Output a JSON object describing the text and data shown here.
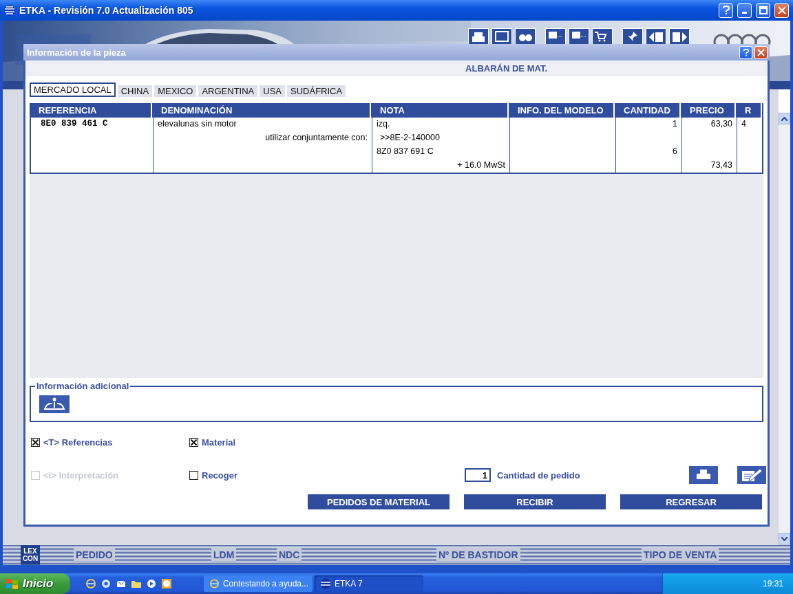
{
  "window": {
    "title": "ETKA - Revisión 7.0 Actualización 805"
  },
  "main_footer": {
    "logo_lines": [
      "LEX",
      "CON"
    ],
    "items": [
      "PEDIDO",
      "LDM",
      "NDC",
      "Nº DE BASTIDOR",
      "TIPO DE VENTA"
    ]
  },
  "dialog": {
    "title": "Información de la pieza",
    "heading": "ALBARÁN DE MAT.",
    "tabs": [
      {
        "label": "MERCADO LOCAL",
        "selected": true
      },
      {
        "label": "CHINA",
        "selected": false
      },
      {
        "label": "MEXICO",
        "selected": false
      },
      {
        "label": "ARGENTINA",
        "selected": false
      },
      {
        "label": "USA",
        "selected": false
      },
      {
        "label": "SUDÁFRICA",
        "selected": false
      }
    ],
    "table": {
      "columns": [
        "REFERENCIA",
        "DENOMINACIÓN",
        "NOTA",
        "INFO. DEL MODELO",
        "CANTIDAD",
        "PRECIO",
        "R"
      ],
      "rows": [
        {
          "kind": "part",
          "cells": [
            "8E0 839 461 C",
            "elevalunas sin motor",
            "izq.",
            "",
            "1",
            "63,30",
            "4"
          ]
        },
        {
          "kind": "link",
          "cells": [
            "",
            "utilizar conjuntamente con:",
            ">>8E-2-140000",
            "",
            "",
            "",
            ""
          ]
        },
        {
          "kind": "part",
          "cells": [
            "",
            "",
            "8Z0 837 691 C",
            "",
            "6",
            "",
            ""
          ]
        },
        {
          "kind": "tax",
          "cells": [
            "",
            "",
            "+  16.0 MwSt",
            "",
            "",
            "73,43",
            ""
          ]
        }
      ]
    },
    "info_section": {
      "title": "Información adicional"
    },
    "checkboxes": [
      {
        "label": "<T> Referencias",
        "checked": true,
        "disabled": false
      },
      {
        "label": "Material",
        "checked": true,
        "disabled": false
      },
      {
        "label": "<I> Interpretación",
        "checked": false,
        "disabled": true
      },
      {
        "label": "Recoger",
        "checked": false,
        "disabled": false
      }
    ],
    "quantity": {
      "value": "1",
      "label": "Cantidad de pedido"
    },
    "buttons": [
      "PEDIDOS DE MATERIAL",
      "RECIBIR",
      "REGRESAR"
    ]
  },
  "taskbar": {
    "start": "Inicio",
    "tasks": [
      {
        "label": "Contestando a ayuda...",
        "selected": false
      },
      {
        "label": "ETKA 7",
        "selected": true
      }
    ],
    "clock": "19:31"
  }
}
